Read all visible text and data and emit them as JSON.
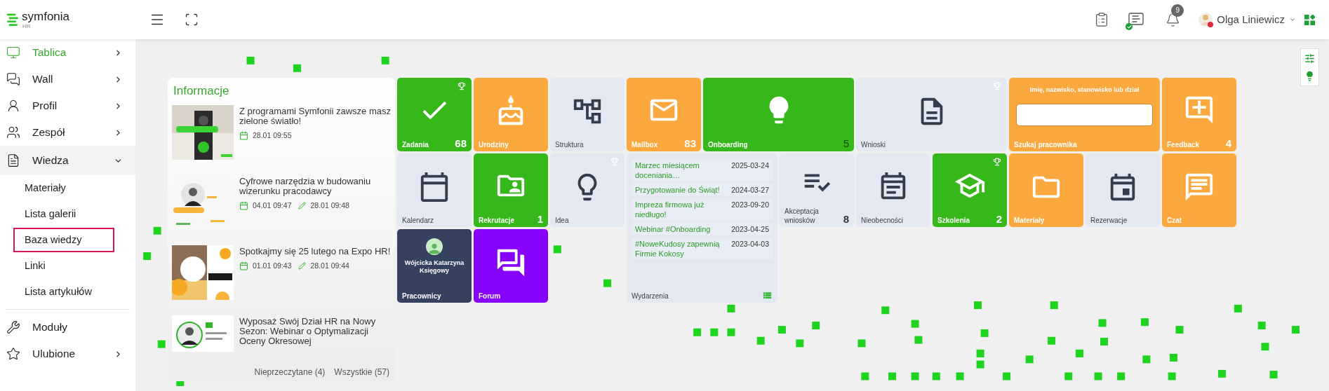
{
  "header": {
    "logo": {
      "name": "symfonia",
      "product": "HR"
    },
    "chat": {
      "connected": true
    },
    "notifications": {
      "count": "9"
    },
    "user": {
      "name": "Olga Liniewicz",
      "busy": true
    }
  },
  "sidebar": {
    "items": [
      {
        "label": "Tablica",
        "selected": true,
        "expanded": false
      },
      {
        "label": "Wall",
        "selected": false,
        "expanded": false
      },
      {
        "label": "Profil",
        "selected": false,
        "expanded": false
      },
      {
        "label": "Zespół",
        "selected": false,
        "expanded": false
      },
      {
        "label": "Wiedza",
        "selected": false,
        "expanded": true,
        "children": [
          {
            "label": "Materiały",
            "highlighted": false
          },
          {
            "label": "Lista galerii",
            "highlighted": false
          },
          {
            "label": "Baza wiedzy",
            "highlighted": true
          },
          {
            "label": "Linki",
            "highlighted": false
          },
          {
            "label": "Lista artykułów",
            "highlighted": false
          }
        ]
      }
    ],
    "bottom_items": [
      {
        "label": "Moduły",
        "selected": false
      },
      {
        "label": "Ulubione",
        "selected": false,
        "expanded": false
      }
    ]
  },
  "news": {
    "title": "Informacje",
    "items": [
      {
        "title": "Z programami Symfonii zawsze masz zielone światło!",
        "created": "28.01 09:55"
      },
      {
        "title": "Cyfrowe narzędzia w budowaniu wizerunku pracodawcy",
        "created": "04.01 09:47",
        "edited": "28.01 09:48"
      },
      {
        "title": "Spotkajmy się 25 lutego na Expo HR!",
        "created": "01.01 09:43",
        "edited": "28.01 09:44"
      },
      {
        "title": "Wyposaż Swój Dział HR na Nowy Sezon: Webinar o Optymalizacji Oceny Okresowej"
      }
    ],
    "footer": [
      "Nieprzeczytane (4)",
      "Wszystkie (57)"
    ]
  },
  "tiles": [
    {
      "kind": "icon",
      "label": "Zadania",
      "color": "#36b81a",
      "count": "68",
      "trophy": true,
      "wide": false
    },
    {
      "kind": "icon",
      "label": "Urodziny",
      "color": "#fba83f",
      "trophy": false,
      "wide": false
    },
    {
      "kind": "icon",
      "label": "Struktura",
      "color": "#e4e9f1",
      "trophy": false,
      "wide": false
    },
    {
      "kind": "icon",
      "label": "Mailbox",
      "color": "#fba83f",
      "count": "83",
      "trophy": false,
      "wide": false
    },
    {
      "kind": "icon",
      "label": "Onboarding",
      "color": "#36b81a",
      "count": "5",
      "trophy": false,
      "wide": true
    },
    {
      "kind": "icon",
      "label": "Wnioski",
      "color": "#e4e9f1",
      "trophy": true,
      "wide": true
    },
    {
      "kind": "search",
      "label": "Szukaj pracownika",
      "color": "#fba83f",
      "hint": "Imię, nazwisko, stanowisko lub dział",
      "wide": true
    },
    {
      "kind": "icon",
      "label": "Feedback",
      "color": "#fba83f",
      "count": "4",
      "trophy": false,
      "wide": false
    },
    {
      "kind": "icon",
      "label": "Kalendarz",
      "color": "#e4e9f1",
      "trophy": false,
      "wide": false
    },
    {
      "kind": "icon",
      "label": "Rekrutacje",
      "color": "#36b81a",
      "count": "1",
      "trophy": false,
      "wide": false
    },
    {
      "kind": "icon",
      "label": "Idea",
      "color": "#e4e9f1",
      "trophy": true,
      "wide": false
    },
    {
      "kind": "events",
      "label": "Wydarzenia",
      "color": "#e4e9f1",
      "wide": true,
      "events": [
        {
          "title": "Marzec miesiącem doceniania…",
          "date": "2025-03-24"
        },
        {
          "title": "Przygotowanie do Świąt!",
          "date": "2024-03-27"
        },
        {
          "title": "Impreza firmowa już niedługo!",
          "date": "2023-09-20"
        },
        {
          "title": "Webinar #Onboarding",
          "date": "2023-04-25"
        },
        {
          "title": "#NoweKudosy zapewnią Firmie Kokosy",
          "date": "2023-04-03"
        }
      ]
    },
    {
      "kind": "icon",
      "label": "Akceptacja wniosków",
      "color": "#e4e9f1",
      "count": "8",
      "trophy": false,
      "wide": false
    },
    {
      "kind": "icon",
      "label": "Nieobecności",
      "color": "#e4e9f1",
      "trophy": false,
      "wide": false
    },
    {
      "kind": "icon",
      "label": "Szkolenia",
      "color": "#36b81a",
      "count": "2",
      "trophy": true,
      "wide": false
    },
    {
      "kind": "icon",
      "label": "Materiały",
      "color": "#fba83f",
      "trophy": false,
      "wide": false
    },
    {
      "kind": "icon",
      "label": "Rezerwacje",
      "color": "#e4e9f1",
      "trophy": false,
      "wide": false
    },
    {
      "kind": "icon",
      "label": "Czat",
      "color": "#fba83f",
      "trophy": false,
      "wide": false
    },
    {
      "kind": "person",
      "label": "Pracownicy",
      "color": "#36415f",
      "person": "Wójcicka Katarzyna",
      "role": "Księgowy",
      "wide": false
    },
    {
      "kind": "icon",
      "label": "Forum",
      "color": "#8602fa",
      "trophy": false,
      "wide": false
    }
  ]
}
